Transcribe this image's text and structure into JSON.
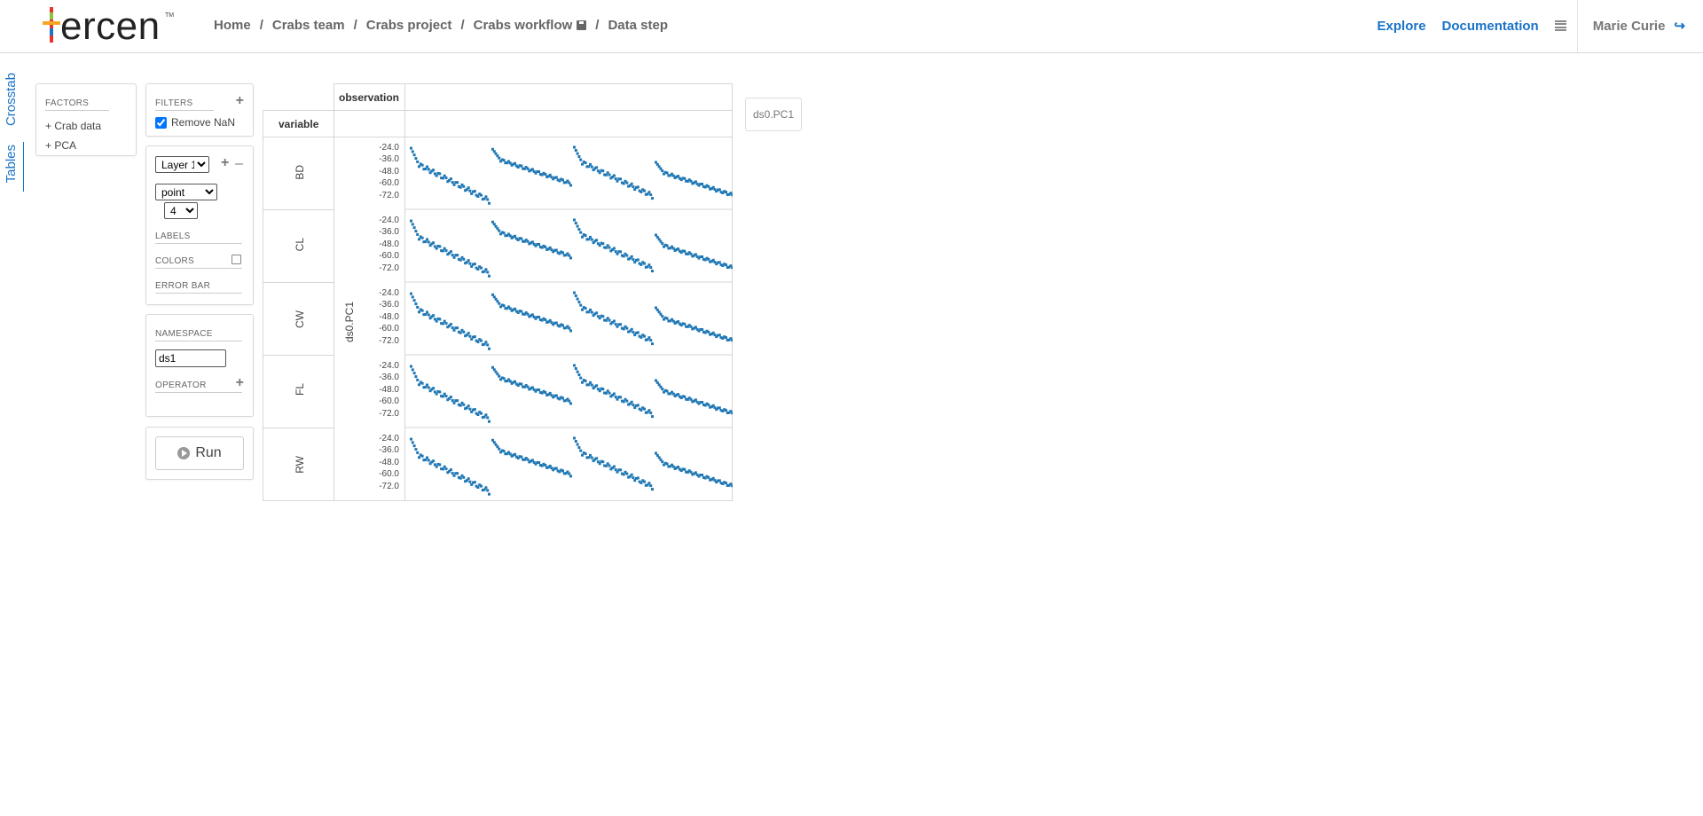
{
  "header": {
    "logo_text": "ercen",
    "logo_tm": "TM",
    "breadcrumbs": [
      "Home",
      "Crabs team",
      "Crabs project",
      "Crabs workflow",
      "Data step"
    ],
    "nav": {
      "explore": "Explore",
      "documentation": "Documentation"
    },
    "user": "Marie Curie"
  },
  "vtabs": {
    "crosstab": "Crosstab",
    "tables": "Tables"
  },
  "factors": {
    "title": "FACTORS",
    "items": [
      "Crab data",
      "PCA"
    ]
  },
  "filters": {
    "title": "FILTERS",
    "remove_nan_label": "Remove NaN",
    "remove_nan_checked": true
  },
  "layer": {
    "layer_select": "Layer 1",
    "chart_type_select": "point",
    "point_size_select": "4",
    "labels_title": "LABELS",
    "colors_title": "COLORS",
    "error_bar_title": "ERROR BAR"
  },
  "namespace": {
    "title": "NAMESPACE",
    "value": "ds1",
    "operator_title": "OPERATOR"
  },
  "run_label": "Run",
  "crosstab": {
    "column_header": "observation",
    "row_header": "variable",
    "y_axis_label": "ds0.PC1",
    "legend": "ds0.PC1"
  },
  "chart_data": {
    "type": "scatter",
    "y_ticks": [
      "-24.0",
      "-36.0",
      "-48.0",
      "-60.0",
      "-72.0"
    ],
    "ylim": [
      -80,
      -18
    ],
    "rows": [
      "BD",
      "CL",
      "CW",
      "FL",
      "RW"
    ],
    "point_color": "#1f77b4",
    "segments": [
      {
        "start": -23,
        "end": -78,
        "steps": 50
      },
      {
        "start": -24,
        "end": -60,
        "steps": 50
      },
      {
        "start": -22,
        "end": -73,
        "steps": 50
      },
      {
        "start": -37,
        "end": -72,
        "steps": 50
      }
    ]
  }
}
